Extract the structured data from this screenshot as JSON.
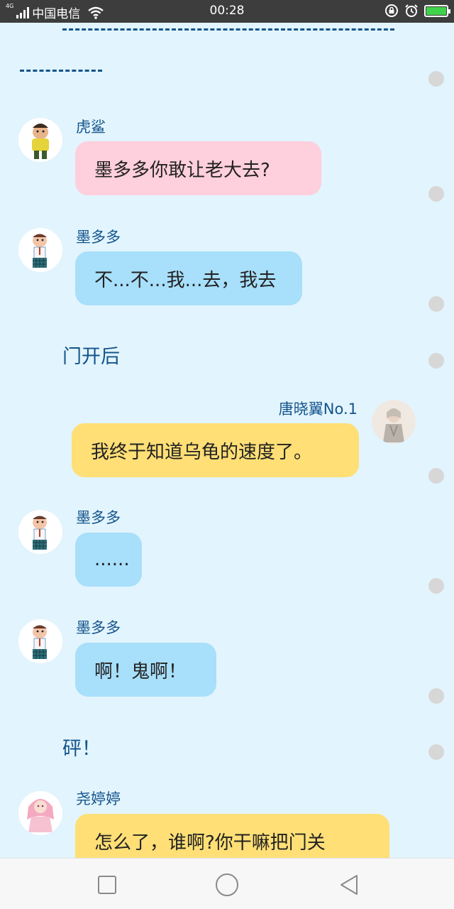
{
  "status_bar": {
    "network_type": "4G",
    "carrier": "中国电信",
    "time": "00:28",
    "icons": [
      "signal-icon",
      "wifi-icon",
      "lock-rotation-icon",
      "alarm-icon",
      "battery-charging-icon"
    ]
  },
  "chat": {
    "messages": [
      {
        "speaker": "虎鲨",
        "text": "墨多多你敢让老大去?",
        "side": "left",
        "bubble_color": "#fecfdc"
      },
      {
        "speaker": "墨多多",
        "text": "不...不...我...去，我去",
        "side": "left",
        "bubble_color": "#a8dffb"
      },
      {
        "narration": "门开后"
      },
      {
        "speaker": "唐晓翼No.1",
        "text": "我终于知道乌龟的速度了。",
        "side": "right",
        "bubble_color": "#ffdf76"
      },
      {
        "speaker": "墨多多",
        "text": "......",
        "side": "left",
        "bubble_color": "#a8dffb"
      },
      {
        "speaker": "墨多多",
        "text": "啊！鬼啊！",
        "side": "left",
        "bubble_color": "#a8dffb"
      },
      {
        "narration": "砰！"
      },
      {
        "speaker": "尧婷婷",
        "text": "怎么了，谁啊?你干嘛把门关",
        "side": "left",
        "bubble_color": "#ffdf76"
      }
    ]
  },
  "nav_bar": {
    "buttons": [
      "recent-apps-button",
      "home-button",
      "back-button"
    ]
  },
  "colors": {
    "background": "#e2f4fd",
    "text_accent": "#14548c",
    "status_bar": "#3d3d3d",
    "battery": "#3fd24a"
  }
}
